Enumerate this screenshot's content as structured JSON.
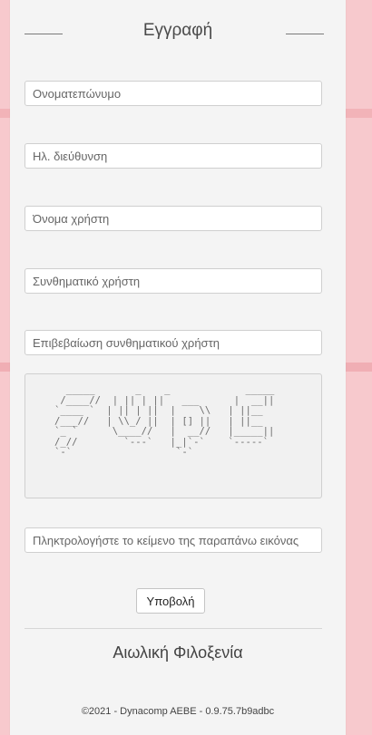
{
  "page": {
    "title": "Εγγραφή"
  },
  "form": {
    "fullname_placeholder": "Ονοματεπώνυμο",
    "email_placeholder": "Ηλ. διεύθυνση",
    "username_placeholder": "Όνομα χρήστη",
    "password_placeholder": "Συνθηματικό χρήστη",
    "confirm_password_placeholder": "Επιβεβαίωση συνθηματικού χρήστη",
    "captcha_placeholder": "Πληκτρολογήστε το κείμενο της παραπάνω εικόνας",
    "submit_label": "Υποβολή"
  },
  "captcha": {
    "ascii": "  _____       _    _             _____\n /____//  | || | ||   ___      |  __||\n`____ `  | || | ||  |    \\\\   | ||__\n/___//   | \\\\_/ ||  | [] ||   | ||__\n`_ `      \\____//   |  __//   |_____||\n/_//        `---`   |_|`-`    `-----`\n`-`                  `-`"
  },
  "brand": {
    "name": "Αιωλική Φιλοξενία"
  },
  "footer": {
    "text": "©2021 - Dynacomp AEBE - 0.9.75.7b9adbc"
  },
  "colors": {
    "background": "#f7c9cd",
    "panel": "#f4f4f4"
  }
}
